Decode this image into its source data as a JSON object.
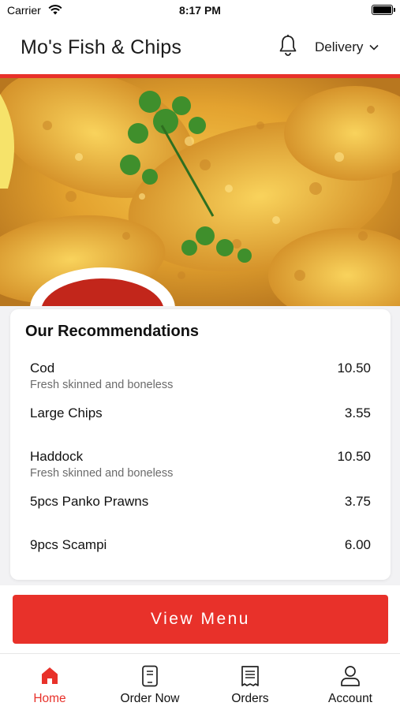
{
  "status_bar": {
    "carrier": "Carrier",
    "time": "8:17 PM"
  },
  "header": {
    "title": "Mo's Fish & Chips",
    "delivery_label": "Delivery"
  },
  "recommendations": {
    "title": "Our Recommendations",
    "items": [
      {
        "name": "Cod",
        "description": "Fresh skinned and boneless",
        "price": "10.50"
      },
      {
        "name": "Large Chips",
        "description": "",
        "price": "3.55"
      },
      {
        "name": "Haddock",
        "description": "Fresh skinned and boneless",
        "price": "10.50"
      },
      {
        "name": "5pcs Panko Prawns",
        "description": "",
        "price": "3.75"
      },
      {
        "name": "9pcs Scampi",
        "description": "",
        "price": "6.00"
      }
    ]
  },
  "view_menu_label": "View Menu",
  "tabs": [
    {
      "label": "Home",
      "icon": "home-icon",
      "active": true
    },
    {
      "label": "Order Now",
      "icon": "order-icon",
      "active": false
    },
    {
      "label": "Orders",
      "icon": "receipt-icon",
      "active": false
    },
    {
      "label": "Account",
      "icon": "person-icon",
      "active": false
    }
  ],
  "colors": {
    "accent": "#e8312a",
    "background": "#f2f2f4"
  }
}
